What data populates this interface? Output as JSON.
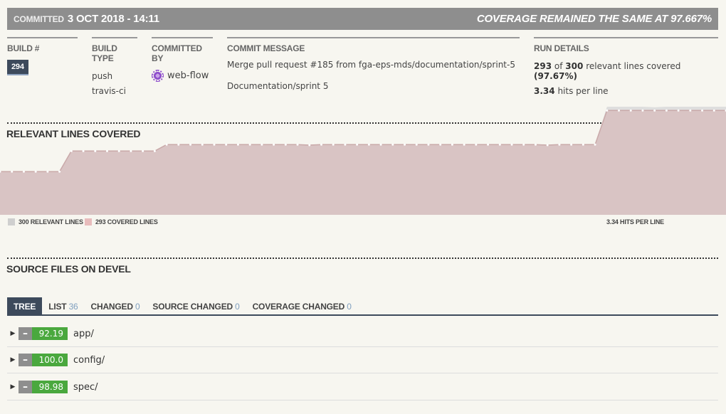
{
  "header": {
    "committed_label": "Committed",
    "committed_date": "3 OCT 2018 - 14:11",
    "coverage_status": "COVERAGE REMAINED THE SAME AT 97.667%"
  },
  "build": {
    "title": "BUILD #",
    "number": "294"
  },
  "build_type": {
    "title": "BUILD TYPE",
    "line1": "push",
    "line2": "travis-ci"
  },
  "committed_by": {
    "title": "COMMITTED BY",
    "name": "web-flow"
  },
  "commit_message": {
    "title": "COMMIT MESSAGE",
    "line1": "Merge pull request #185 from fga-eps-mds/documentation/sprint-5",
    "line2": "Documentation/sprint 5"
  },
  "run_details": {
    "title": "RUN DETAILS",
    "covered": "293",
    "of_text": "of",
    "relevant": "300",
    "relevant_text": "relevant lines covered",
    "percent": "(97.67%)",
    "hits": "3.34",
    "hits_text": "hits per line"
  },
  "chart_section": {
    "title": "RELEVANT LINES COVERED",
    "legend_relevant": "300 RELEVANT LINES",
    "legend_covered": "293 COVERED LINES",
    "legend_hits": "3.34 HITS PER LINE"
  },
  "chart_data": {
    "type": "area",
    "series": [
      {
        "color": "#dedede",
        "values": [
          180,
          180,
          180,
          180,
          180,
          180,
          218,
          218,
          218,
          218,
          218,
          218,
          218,
          218,
          230,
          230,
          230,
          230,
          230,
          230,
          230,
          230,
          230,
          230,
          230,
          230,
          230,
          230,
          230,
          230,
          230,
          230,
          230,
          230,
          230,
          230,
          230,
          230,
          230,
          230,
          230,
          230,
          230,
          230,
          230,
          230,
          230,
          230,
          230,
          230,
          230,
          300,
          300,
          300,
          300,
          299,
          300,
          300,
          300,
          300,
          300,
          300
        ]
      },
      {
        "color": "#d9c4c4",
        "values": [
          180,
          180,
          180,
          180,
          180,
          180,
          218,
          218,
          218,
          218,
          218,
          218,
          218,
          218,
          230,
          230,
          230,
          230,
          230,
          230,
          230,
          230,
          230,
          230,
          230,
          230,
          229,
          230,
          230,
          230,
          230,
          230,
          230,
          230,
          230,
          230,
          230,
          230,
          230,
          230,
          230,
          230,
          230,
          230,
          230,
          230,
          229,
          230,
          230,
          230,
          230,
          293,
          293,
          293,
          293,
          293,
          293,
          293,
          293,
          293,
          293,
          293
        ]
      }
    ],
    "ylim": [
      100,
      300
    ]
  },
  "source_files": {
    "title": "SOURCE FILES ON DEVEL",
    "tabs": [
      {
        "label": "TREE",
        "count": ""
      },
      {
        "label": "LIST",
        "count": "36"
      },
      {
        "label": "CHANGED",
        "count": "0"
      },
      {
        "label": "SOURCE CHANGED",
        "count": "0"
      },
      {
        "label": "COVERAGE CHANGED",
        "count": "0"
      }
    ],
    "files": [
      {
        "coverage": "92.19",
        "name": "app/"
      },
      {
        "coverage": "100.0",
        "name": "config/"
      },
      {
        "coverage": "98.98",
        "name": "spec/"
      }
    ]
  }
}
